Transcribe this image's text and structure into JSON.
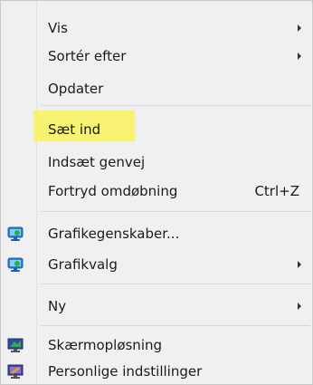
{
  "menu": {
    "items": {
      "vis": "Vis",
      "sort_by": "Sortér efter",
      "refresh": "Opdater",
      "paste": "Sæt ind",
      "paste_shortcut": "Indsæt genvej",
      "undo_rename": "Fortryd omdøbning",
      "undo_rename_shortcut_key": "Ctrl+Z",
      "graphics_properties": "Grafikegenskaber...",
      "graphics_options": "Grafikvalg",
      "new": "Ny",
      "screen_resolution": "Skærmopløsning",
      "personalize": "Personlige indstillinger"
    }
  },
  "colors": {
    "highlight": "#f9f25a",
    "menu_bg": "#f0f0f0"
  }
}
